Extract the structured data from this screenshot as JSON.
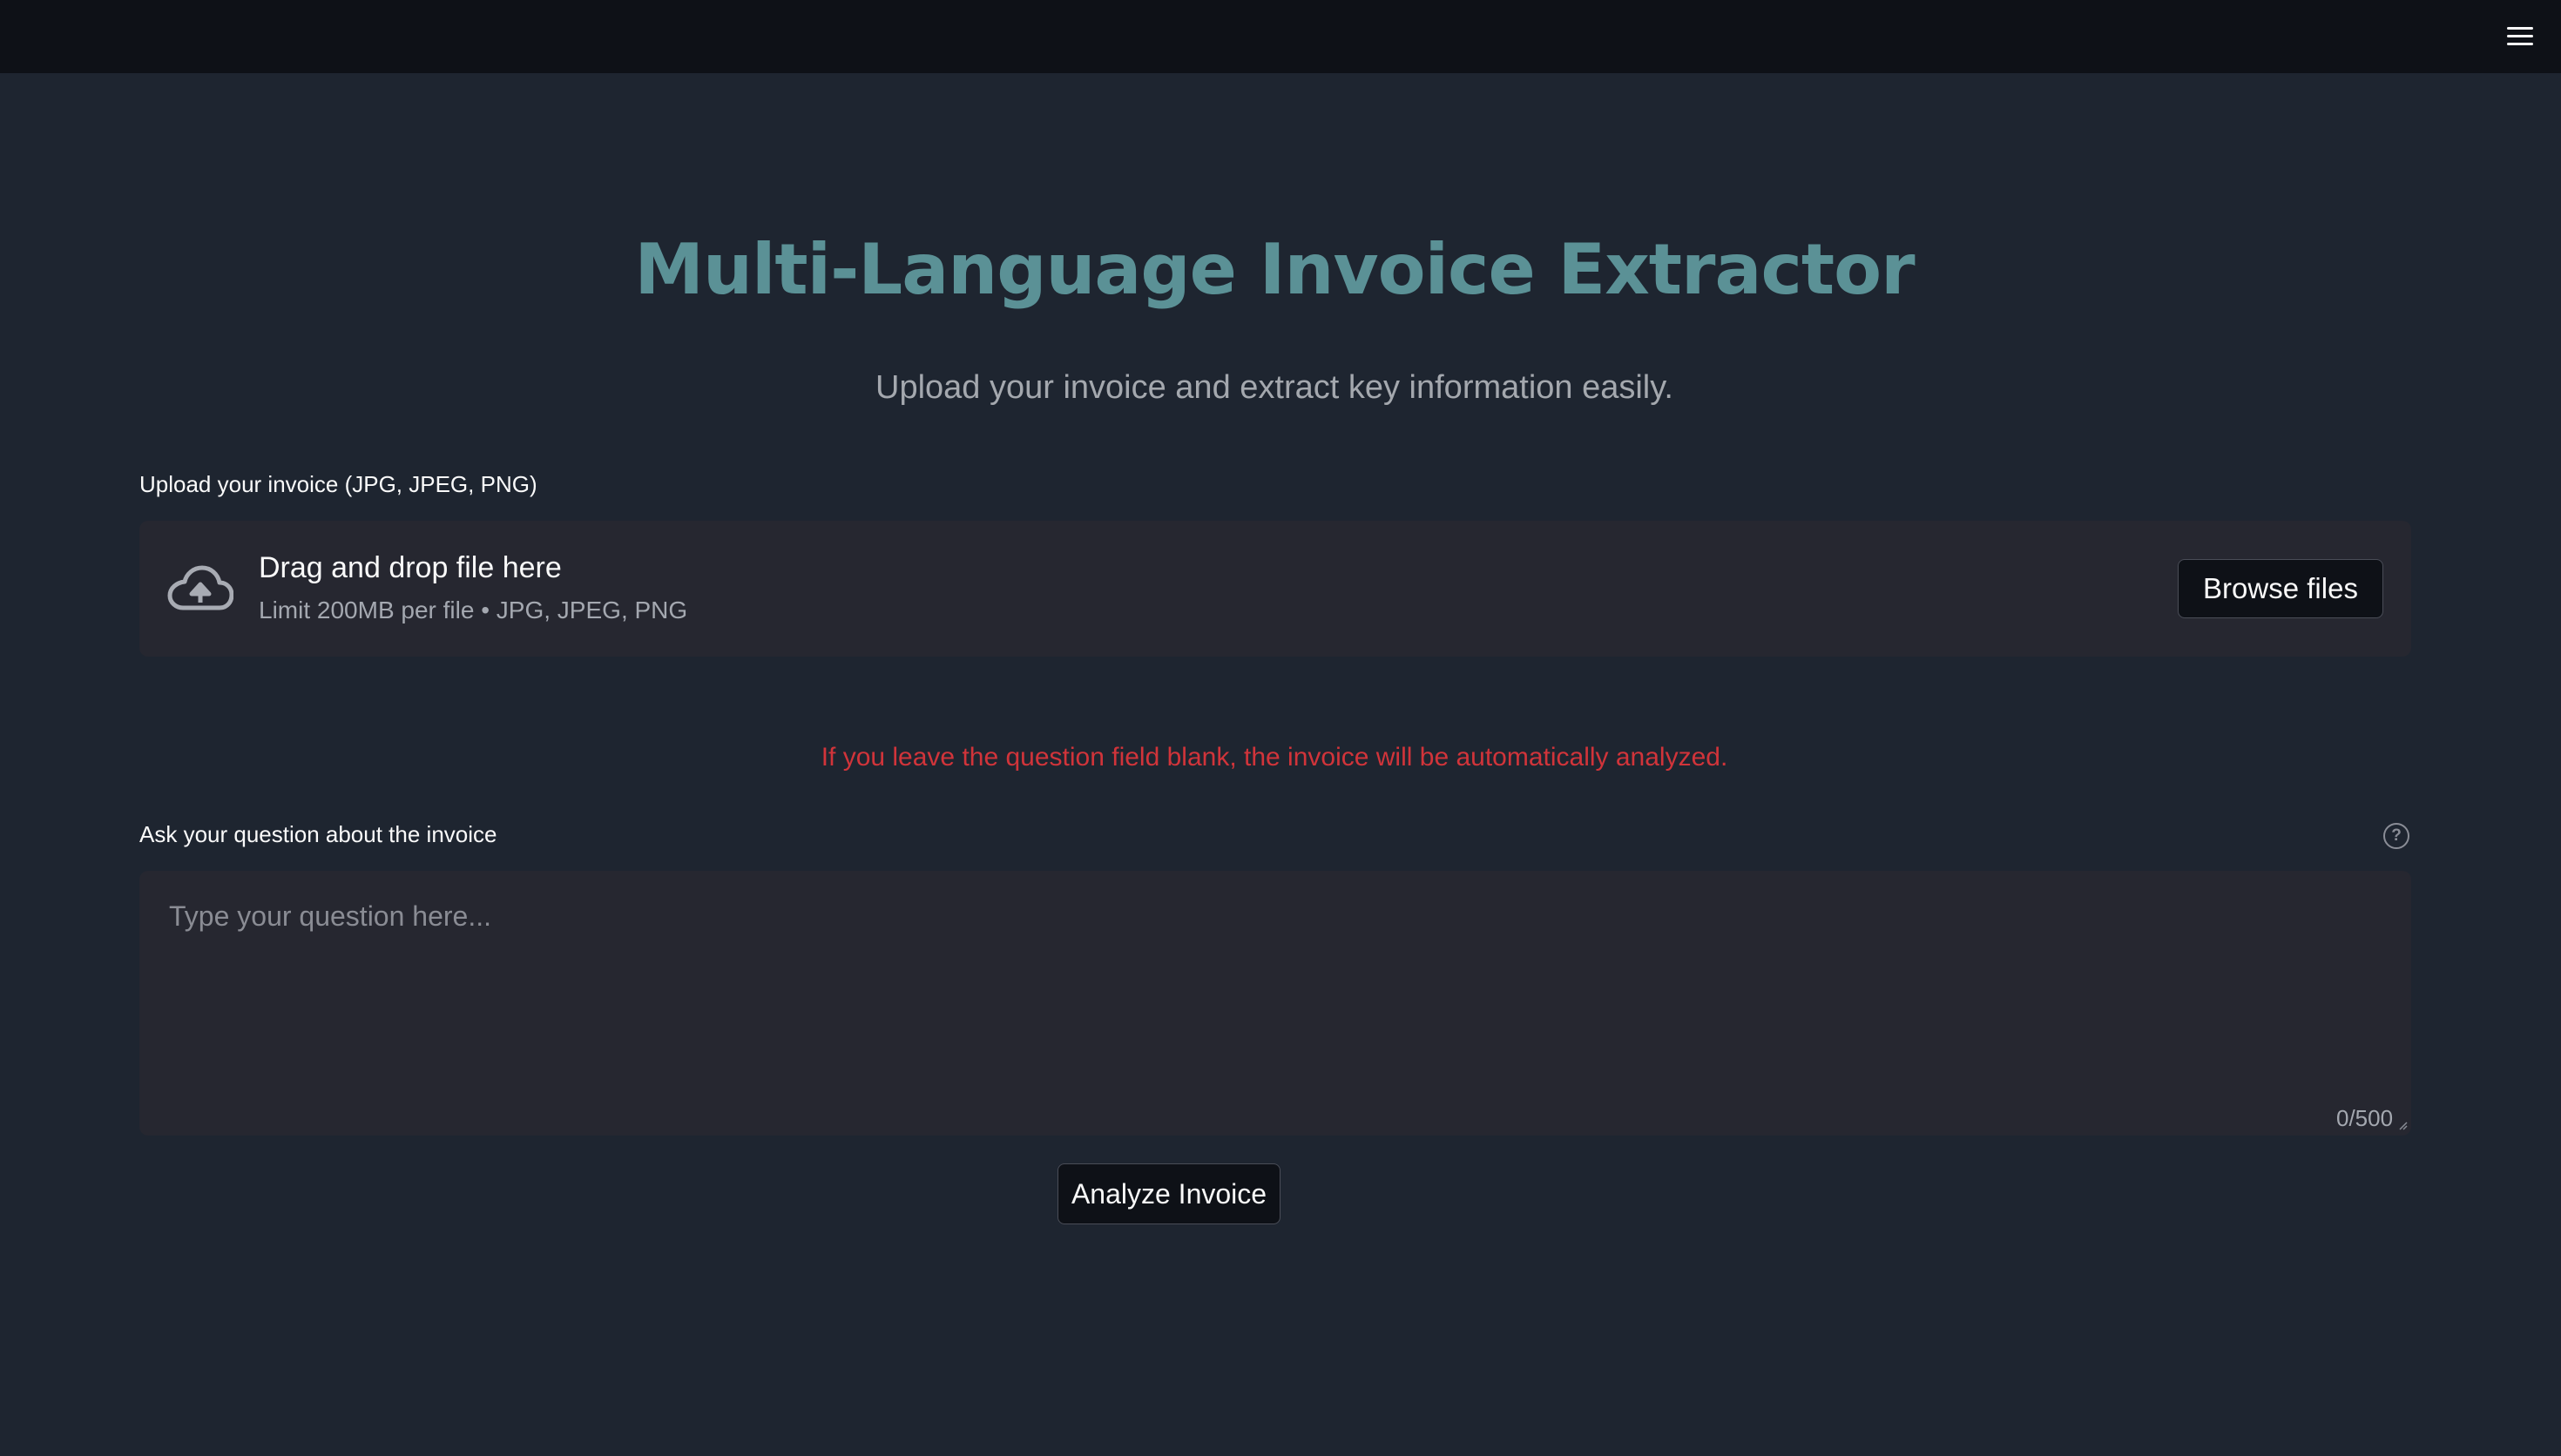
{
  "header": {
    "menu_icon": "hamburger-menu-icon"
  },
  "main": {
    "title": "Multi-Language Invoice Extractor",
    "subtitle": "Upload your invoice and extract key information easily."
  },
  "uploader": {
    "label": "Upload your invoice (JPG, JPEG, PNG)",
    "icon": "cloud-upload-icon",
    "dropzone_title": "Drag and drop file here",
    "dropzone_limit": "Limit 200MB per file • JPG, JPEG, PNG",
    "browse_label": "Browse files"
  },
  "warning": {
    "text": "If you leave the question field blank, the invoice will be automatically analyzed.",
    "color": "#d1343a"
  },
  "question": {
    "label": "Ask your question about the invoice",
    "help_icon": "help-circle-icon",
    "placeholder": "Type your question here...",
    "value": "",
    "char_count": "0/500"
  },
  "actions": {
    "analyze_label": "Analyze Invoice"
  },
  "colors": {
    "background": "#1e2530",
    "topbar": "#0e1117",
    "title": "#5b9196",
    "input_background": "#262730"
  }
}
